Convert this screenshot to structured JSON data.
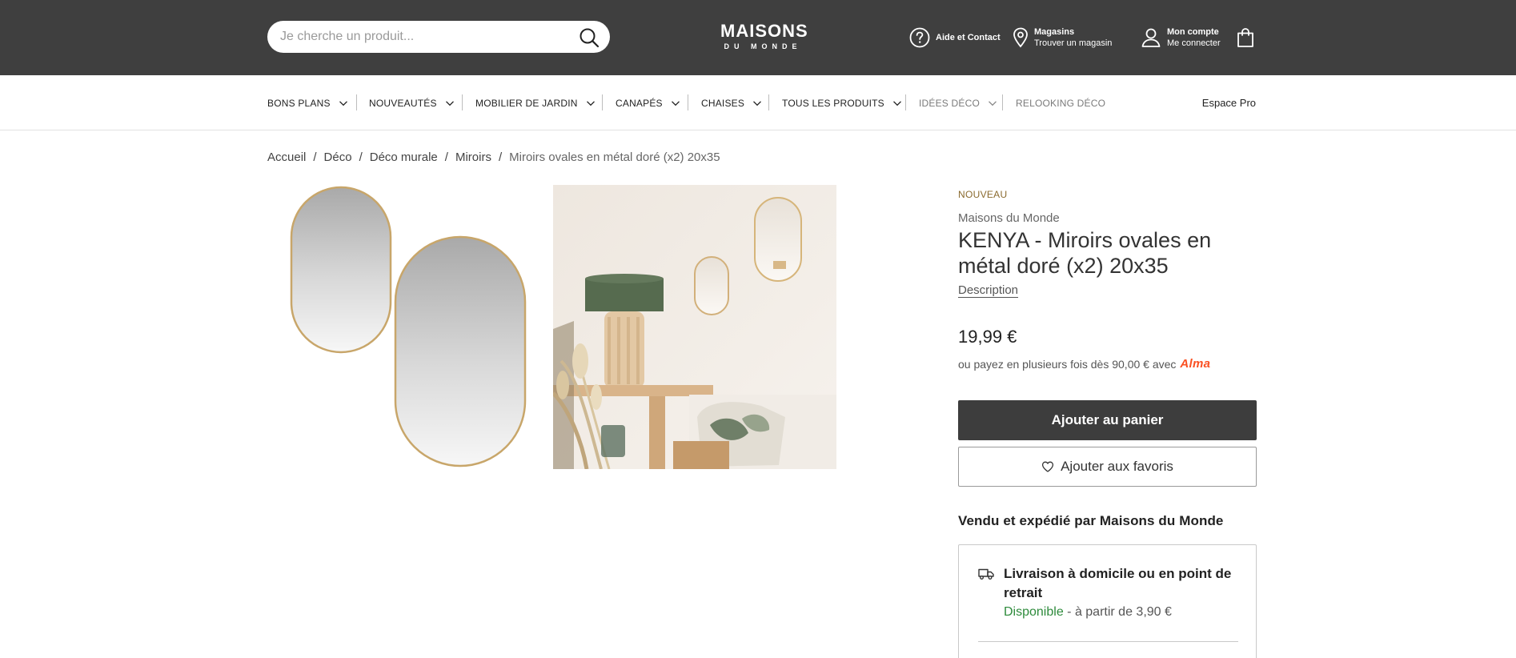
{
  "header": {
    "search_placeholder": "Je cherche un produit...",
    "logo_line1": "MAISONS",
    "logo_line2": "DU MONDE",
    "help_label": "Aide et Contact",
    "stores_label": "Magasins",
    "stores_sub": "Trouver un magasin",
    "account_label": "Mon compte",
    "account_sub": "Me connecter"
  },
  "nav": {
    "items": [
      {
        "label": "BONS PLANS"
      },
      {
        "label": "NOUVEAUTÉS"
      },
      {
        "label": "MOBILIER DE JARDIN"
      },
      {
        "label": "CANAPÉS"
      },
      {
        "label": "CHAISES"
      },
      {
        "label": "TOUS LES PRODUITS"
      },
      {
        "label": "IDÉES DÉCO"
      },
      {
        "label": "RELOOKING DÉCO"
      }
    ],
    "espace_pro": "Espace Pro"
  },
  "breadcrumb": {
    "items": [
      "Accueil",
      "Déco",
      "Déco murale",
      "Miroirs"
    ],
    "current": "Miroirs ovales en métal doré (x2) 20x35",
    "separator": "/"
  },
  "product": {
    "badge": "NOUVEAU",
    "brand": "Maisons du Monde",
    "title": "KENYA - Miroirs ovales en métal doré (x2) 20x35",
    "description_link": "Description",
    "price": "19,99 €",
    "installment_text": "ou payez en plusieurs fois dès 90,00 € avec",
    "installment_brand": "Alma",
    "add_to_cart": "Ajouter au panier",
    "add_to_favorites": "Ajouter aux favoris",
    "seller": "Vendu et expédié par Maisons du Monde",
    "delivery_title": "Livraison à domicile ou en point de retrait",
    "delivery_available": "Disponible",
    "delivery_price": " - à partir de 3,90 €"
  },
  "colors": {
    "header_bg": "#3f3f3f",
    "cart_button_bg": "#3d3d3d",
    "badge_new": "#8a6a2e",
    "alma": "#fa5022",
    "available": "#2e8b3c"
  }
}
